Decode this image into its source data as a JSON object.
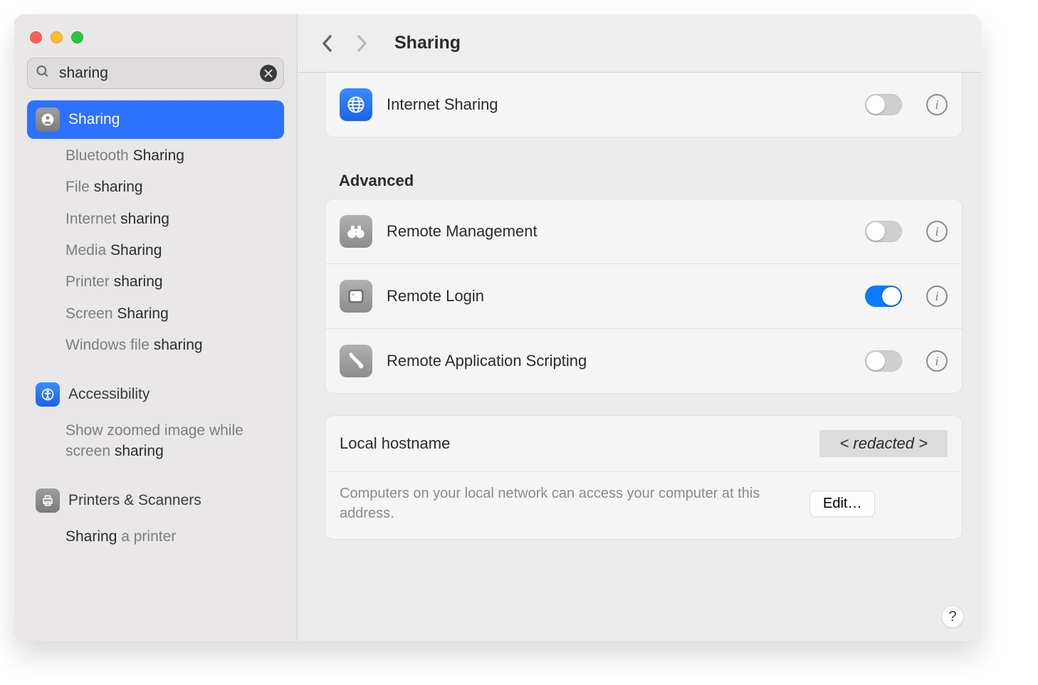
{
  "search": {
    "value": "sharing"
  },
  "title": "Sharing",
  "sidebar": {
    "primary": {
      "label": "Sharing"
    },
    "subs": [
      {
        "pre": "Bluetooth ",
        "hl": "Sharing"
      },
      {
        "pre": "File ",
        "hl": "sharing"
      },
      {
        "pre": "Internet ",
        "hl": "sharing"
      },
      {
        "pre": "Media ",
        "hl": "Sharing"
      },
      {
        "pre": "Printer ",
        "hl": "sharing"
      },
      {
        "pre": "Screen ",
        "hl": "Sharing"
      },
      {
        "pre": "Windows file ",
        "hl": "sharing"
      }
    ],
    "access": {
      "label": "Accessibility"
    },
    "accessSub": {
      "pre": "Show zoomed image while screen ",
      "hl": "sharing"
    },
    "printers": {
      "label": "Printers & Scanners"
    },
    "printersSub": {
      "pre": "",
      "hl": "Sharing",
      "post": " a printer"
    }
  },
  "topcard": {
    "internet": {
      "label": "Internet Sharing",
      "on": false
    }
  },
  "advanced": {
    "header": "Advanced",
    "items": [
      {
        "key": "remote-management",
        "label": "Remote Management",
        "icon": "binoculars",
        "on": false
      },
      {
        "key": "remote-login",
        "label": "Remote Login",
        "icon": "terminal",
        "on": true
      },
      {
        "key": "remote-app-scripting",
        "label": "Remote Application Scripting",
        "icon": "script",
        "on": false
      }
    ]
  },
  "hostname": {
    "label": "Local hostname",
    "value": "< redacted >",
    "desc": "Computers on your local network can access your computer at this address.",
    "edit": "Edit…"
  },
  "help": "?"
}
